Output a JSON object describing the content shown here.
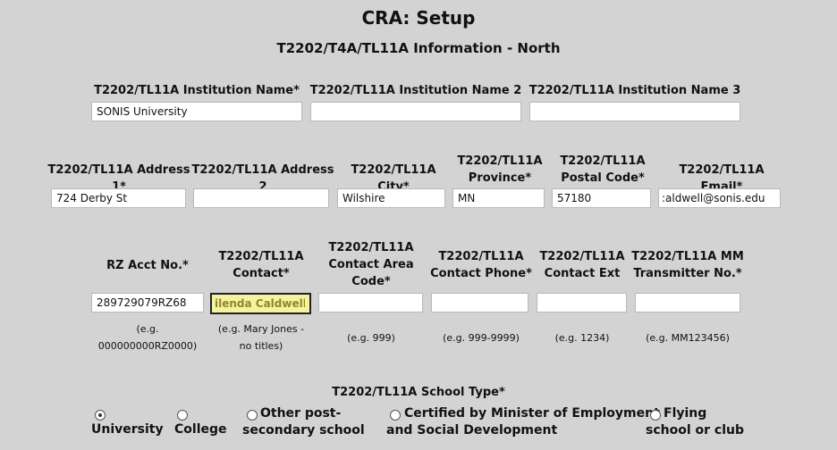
{
  "page": {
    "title": "CRA: Setup",
    "subtitle": "T2202/T4A/TL11A Information - North"
  },
  "row1": {
    "inst_name_label": "T2202/TL11A Institution Name*",
    "inst_name_value": "SONIS University",
    "inst_name2_label": "T2202/TL11A Institution Name 2",
    "inst_name2_value": "",
    "inst_name3_label": "T2202/TL11A Institution Name 3",
    "inst_name3_value": ""
  },
  "row2": {
    "address1_label": "T2202/TL11A Address 1*",
    "address1_value": "724 Derby St",
    "address2_label": "T2202/TL11A Address 2",
    "address2_value": "",
    "city_label": "T2202/TL11A City*",
    "city_value": "Wilshire",
    "province_label_1": "T2202/TL11A",
    "province_label_2": "Province*",
    "province_value": "MN",
    "postal_label_1": "T2202/TL11A",
    "postal_label_2": "Postal Code*",
    "postal_value": "57180",
    "email_label": "T2202/TL11A Email*",
    "email_value": ":aldwell@sonis.edu"
  },
  "row3": {
    "rz_label": "RZ Acct No.*",
    "rz_value": "289729079RZ68",
    "rz_hint_1": "(e.g.",
    "rz_hint_2": "000000000RZ0000)",
    "contact_label_1": "T2202/TL11A",
    "contact_label_2": "Contact*",
    "contact_value": "ilenda Caldwell",
    "contact_hint_1": "(e.g. Mary Jones -",
    "contact_hint_2": "no titles)",
    "area_label_1": "T2202/TL11A",
    "area_label_2": "Contact Area",
    "area_label_3": "Code*",
    "area_value": "",
    "area_hint": "(e.g. 999)",
    "phone_label_1": "T2202/TL11A",
    "phone_label_2": "Contact Phone*",
    "phone_value": "",
    "phone_hint": "(e.g. 999-9999)",
    "ext_label_1": "T2202/TL11A",
    "ext_label_2": "Contact Ext",
    "ext_value": "",
    "ext_hint": "(e.g. 1234)",
    "mm_label_1": "T2202/TL11A MM",
    "mm_label_2": "Transmitter No.*",
    "mm_value": "",
    "mm_hint": "(e.g. MM123456)"
  },
  "school_type": {
    "label": "T2202/TL11A School Type*",
    "options": [
      {
        "line1": "",
        "line2": "University",
        "checked": true
      },
      {
        "line1": "",
        "line2": "College",
        "checked": false
      },
      {
        "line1": "Other post-",
        "line2": "secondary school",
        "checked": false
      },
      {
        "line1": "Certified by Minister of Employment",
        "line2": "and Social Development",
        "checked": false
      },
      {
        "line1": "Flying",
        "line2": "school or club",
        "checked": false
      }
    ]
  }
}
